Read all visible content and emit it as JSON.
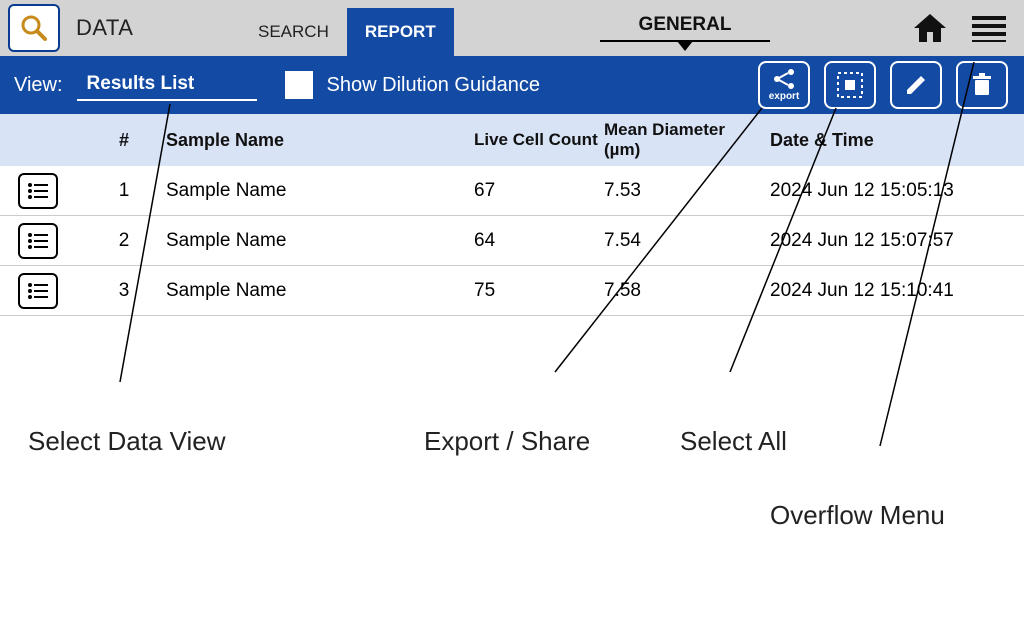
{
  "topbar": {
    "title": "DATA",
    "tabs": {
      "search": "SEARCH",
      "report": "REPORT"
    },
    "general": "GENERAL"
  },
  "toolbar": {
    "view_label": "View:",
    "view_value": "Results List",
    "dilution": "Show Dilution Guidance",
    "export_label": "export"
  },
  "table": {
    "headers": {
      "num": "#",
      "name": "Sample Name",
      "live": "Live Cell Count",
      "mean": "Mean Diameter (µm)",
      "date": "Date & Time"
    },
    "rows": [
      {
        "num": "1",
        "name": "Sample Name",
        "live": "67",
        "mean": "7.53",
        "date": "2024 Jun 12 15:05:13"
      },
      {
        "num": "2",
        "name": "Sample Name",
        "live": "64",
        "mean": "7.54",
        "date": "2024 Jun 12 15:07:57"
      },
      {
        "num": "3",
        "name": "Sample Name",
        "live": "75",
        "mean": "7.58",
        "date": "2024 Jun 12 15:10:41"
      }
    ]
  },
  "callouts": {
    "select_view": "Select Data View",
    "export_share": "Export / Share",
    "select_all": "Select All",
    "overflow": "Overflow Menu"
  }
}
